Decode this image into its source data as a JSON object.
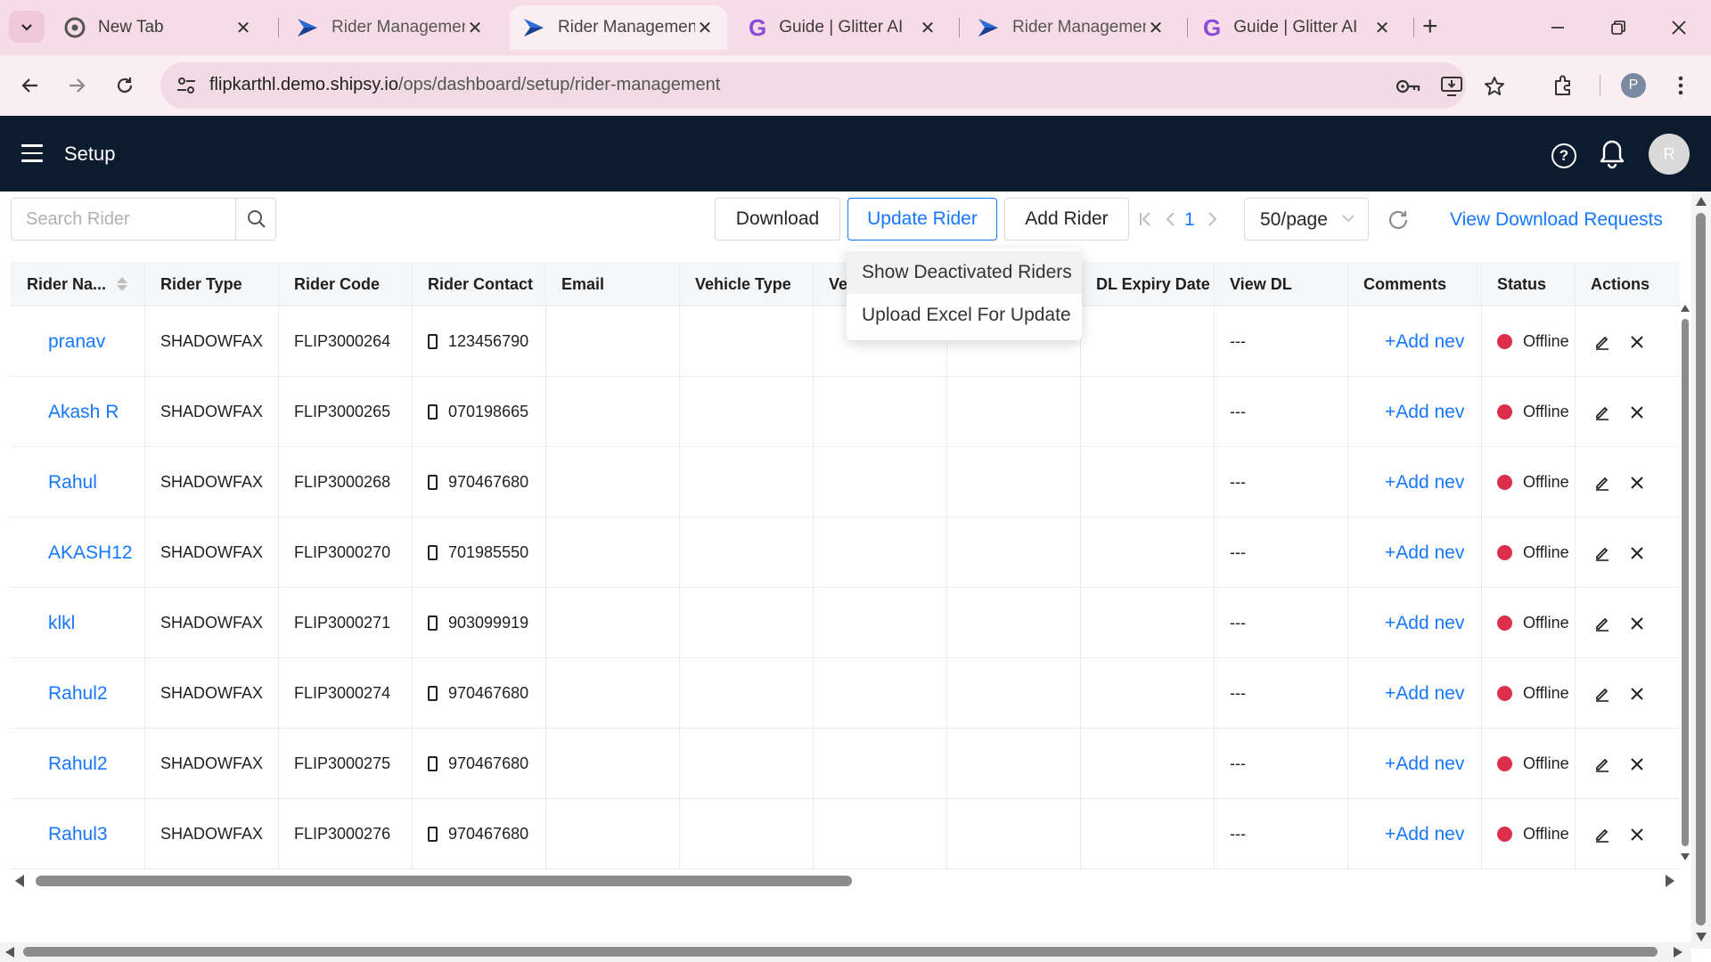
{
  "browser": {
    "tabs": [
      {
        "title": "New Tab",
        "icon": "chrome-icon",
        "active": false
      },
      {
        "title": "Rider Managemen",
        "icon": "shipsy-icon",
        "active": false
      },
      {
        "title": "Rider Managemen",
        "icon": "shipsy-icon",
        "active": true
      },
      {
        "title": "Guide | Glitter AI",
        "icon": "glitter-icon",
        "active": false
      },
      {
        "title": "Rider Managemen",
        "icon": "shipsy-icon",
        "active": false
      },
      {
        "title": "Guide | Glitter AI",
        "icon": "glitter-icon",
        "active": false
      }
    ],
    "new_tab": "+",
    "url_host": "flipkarthl.demo.shipsy.io",
    "url_path": "/ops/dashboard/setup/rider-management",
    "profile_initial": "P"
  },
  "app": {
    "title": "Setup",
    "help": "?",
    "user_initial": "R"
  },
  "toolbar": {
    "search_placeholder": "Search Rider",
    "download": "Download",
    "update_rider": "Update Rider",
    "add_rider": "Add Rider",
    "page": "1",
    "page_size": "50/page",
    "view_download_requests": "View Download Requests"
  },
  "dropdown": {
    "items": [
      "Show Deactivated Riders",
      "Upload Excel For Update"
    ]
  },
  "table": {
    "columns": [
      "Rider Na...",
      "Rider Type",
      "Rider Code",
      "Rider Contact",
      "Email",
      "Vehicle Type",
      "Ve",
      "",
      "DL Expiry Date",
      "View DL",
      "Comments",
      "Status",
      "Actions"
    ],
    "rows": [
      {
        "name": "pranav",
        "type": "SHADOWFAX",
        "code": "FLIP3000264",
        "contact": "123456790",
        "view_dl": "---",
        "comment": "+Add nev",
        "status": "Offline"
      },
      {
        "name": "Akash R",
        "type": "SHADOWFAX",
        "code": "FLIP3000265",
        "contact": "070198665",
        "view_dl": "---",
        "comment": "+Add nev",
        "status": "Offline"
      },
      {
        "name": "Rahul",
        "type": "SHADOWFAX",
        "code": "FLIP3000268",
        "contact": "970467680",
        "view_dl": "---",
        "comment": "+Add nev",
        "status": "Offline"
      },
      {
        "name": "AKASH12",
        "type": "SHADOWFAX",
        "code": "FLIP3000270",
        "contact": "701985550",
        "view_dl": "---",
        "comment": "+Add nev",
        "status": "Offline"
      },
      {
        "name": "klkl",
        "type": "SHADOWFAX",
        "code": "FLIP3000271",
        "contact": "903099919",
        "view_dl": "---",
        "comment": "+Add nev",
        "status": "Offline"
      },
      {
        "name": "Rahul2",
        "type": "SHADOWFAX",
        "code": "FLIP3000274",
        "contact": "970467680",
        "view_dl": "---",
        "comment": "+Add nev",
        "status": "Offline"
      },
      {
        "name": "Rahul2",
        "type": "SHADOWFAX",
        "code": "FLIP3000275",
        "contact": "970467680",
        "view_dl": "---",
        "comment": "+Add nev",
        "status": "Offline"
      },
      {
        "name": "Rahul3",
        "type": "SHADOWFAX",
        "code": "FLIP3000276",
        "contact": "970467680",
        "view_dl": "---",
        "comment": "+Add nev",
        "status": "Offline"
      }
    ]
  },
  "colors": {
    "header_bg": "#0d1b2e",
    "accent": "#1677ff",
    "offline": "#dc2f4c",
    "tabbar": "#f7dbe6"
  }
}
